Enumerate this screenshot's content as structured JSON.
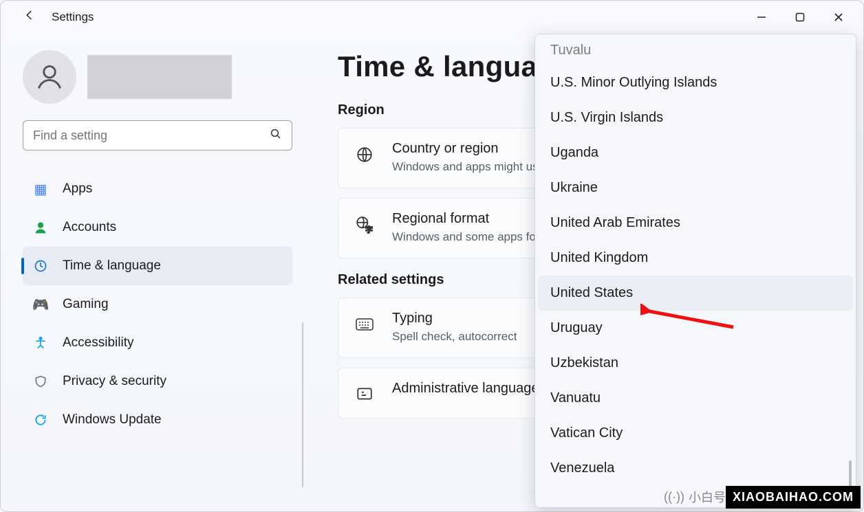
{
  "window": {
    "app_title": "Settings"
  },
  "search": {
    "placeholder": "Find a setting"
  },
  "nav": {
    "items": [
      {
        "label": "Apps"
      },
      {
        "label": "Accounts"
      },
      {
        "label": "Time & language"
      },
      {
        "label": "Gaming"
      },
      {
        "label": "Accessibility"
      },
      {
        "label": "Privacy & security"
      },
      {
        "label": "Windows Update"
      }
    ],
    "selected_index": 2
  },
  "page": {
    "title": "Time & language",
    "sections": {
      "region": {
        "heading": "Region",
        "country": {
          "title": "Country or region",
          "subtitle": "Windows and apps might use your country or region to give you local content"
        },
        "format": {
          "title": "Regional format",
          "subtitle": "Windows and some apps format dates and times based on your regional format"
        }
      },
      "related": {
        "heading": "Related settings",
        "typing": {
          "title": "Typing",
          "subtitle": "Spell check, autocorrect"
        },
        "admin": {
          "title": "Administrative language"
        }
      }
    }
  },
  "dropdown": {
    "partial_top": "Tuvalu",
    "items": [
      "U.S. Minor Outlying Islands",
      "U.S. Virgin Islands",
      "Uganda",
      "Ukraine",
      "United Arab Emirates",
      "United Kingdom",
      "United States",
      "Uruguay",
      "Uzbekistan",
      "Vanuatu",
      "Vatican City",
      "Venezuela"
    ],
    "highlight_index": 6
  },
  "watermark": {
    "brand_cn": "小白号",
    "brand_url": "XIAOBAIHAO.COM"
  }
}
